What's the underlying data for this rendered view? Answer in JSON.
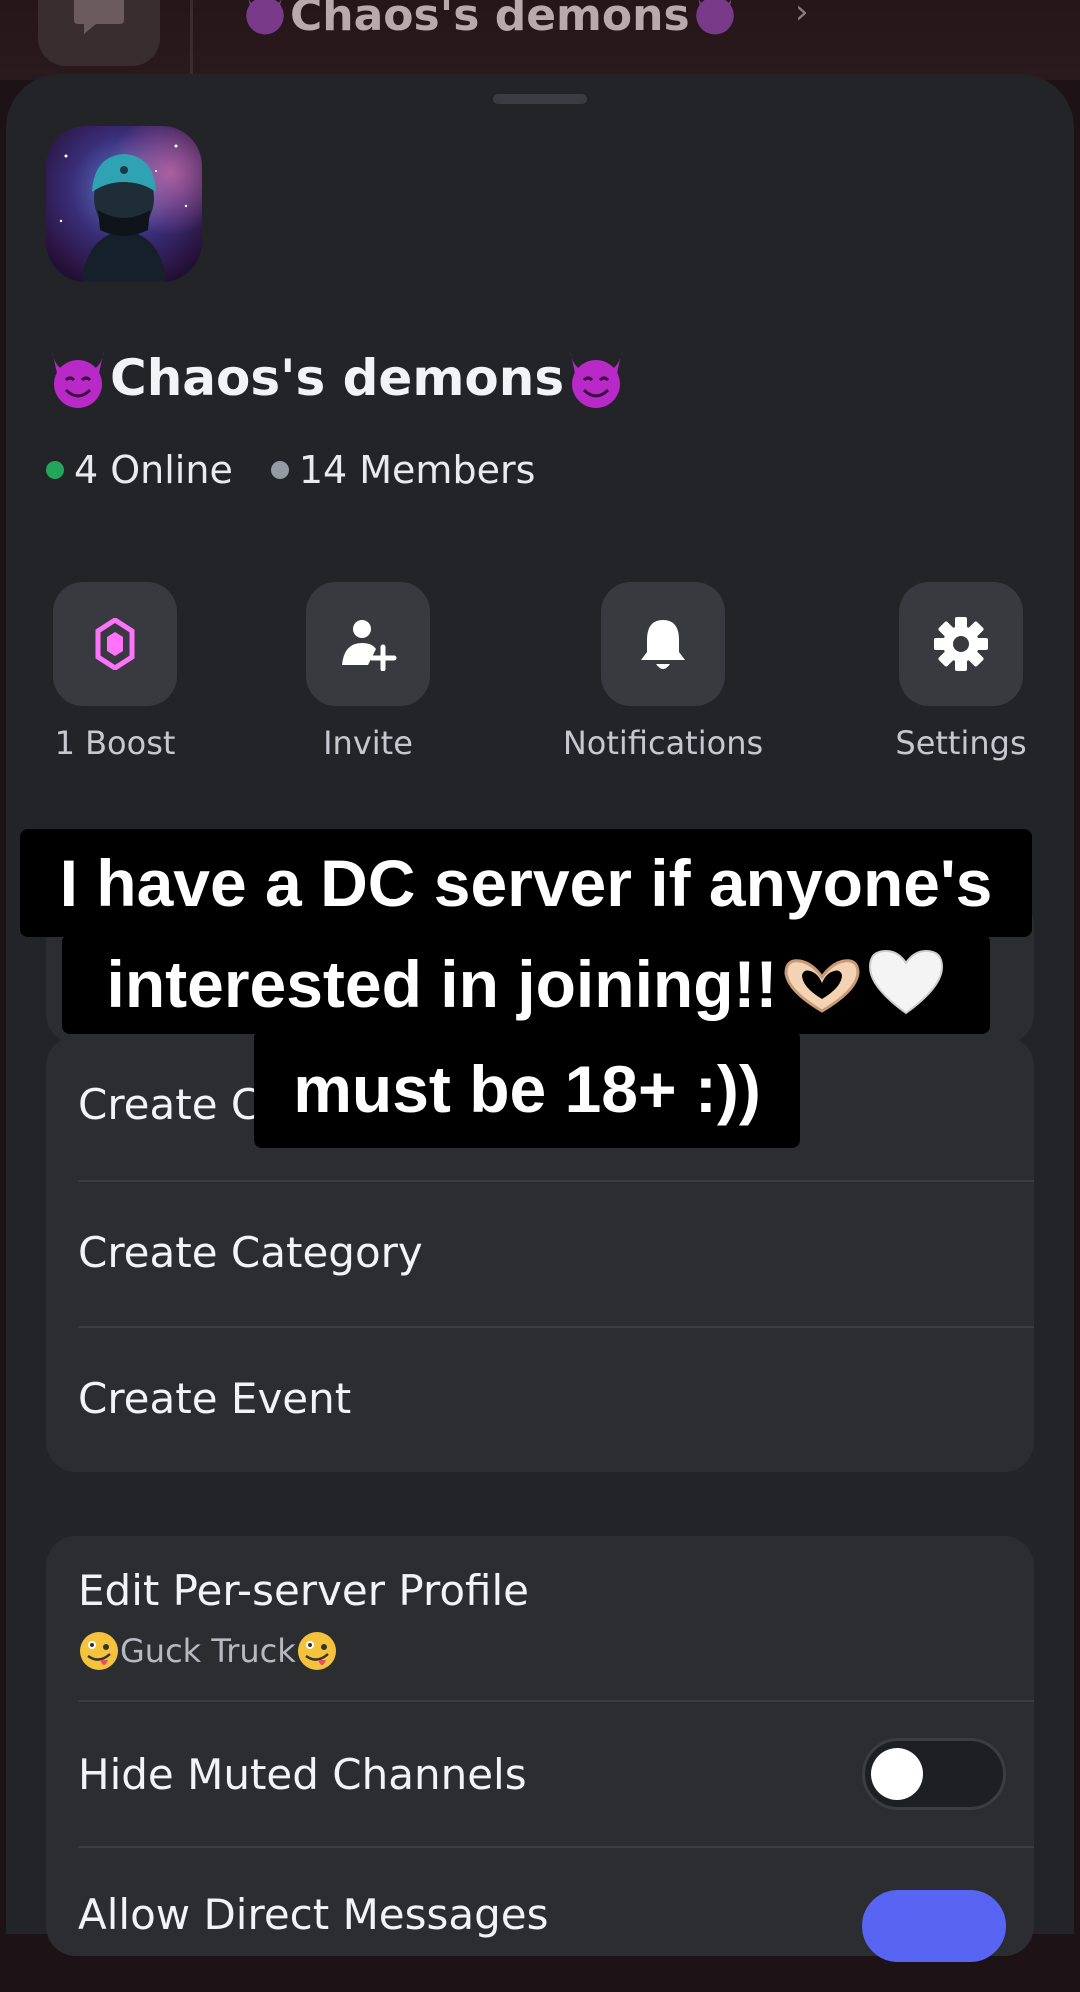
{
  "background": {
    "channel_title": "Chaos's demons"
  },
  "server": {
    "name": "Chaos's demons",
    "online": "4 Online",
    "members": "14 Members"
  },
  "actions": [
    {
      "label": "1 Boost",
      "icon": "boost-gem-icon"
    },
    {
      "label": "Invite",
      "icon": "invite-person-plus-icon"
    },
    {
      "label": "Notifications",
      "icon": "bell-icon"
    },
    {
      "label": "Settings",
      "icon": "gear-icon"
    }
  ],
  "create_menu": {
    "create_channel": "Create C",
    "create_category": "Create Category",
    "create_event": "Create Event"
  },
  "profile_menu": {
    "edit_profile": "Edit Per-server Profile",
    "nickname": "Guck Truck",
    "hide_muted": "Hide Muted Channels",
    "hide_muted_on": false,
    "allow_dms": "Allow Direct Messages"
  },
  "caption": {
    "line1": "I have a DC server if anyone's",
    "line2": "interested in joining!!",
    "line3": "must be 18+ :))"
  },
  "colors": {
    "online": "#23a55a",
    "boost": "#ff73fa",
    "sheet": "#232428",
    "card": "#2b2d31",
    "toggle_on": "#5865f2"
  }
}
